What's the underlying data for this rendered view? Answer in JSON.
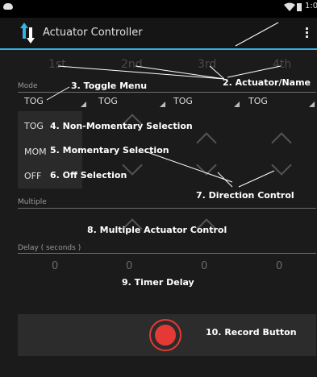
{
  "status_bar": {
    "time": "1:0",
    "wifi_icon": "wifi-icon",
    "battery_icon": "battery-icon",
    "cloud_icon": "cloud-upload-icon"
  },
  "action_bar": {
    "title": "Actuator Controller",
    "app_icon": "up-down-arrows-icon",
    "overflow_icon": "overflow-menu-icon"
  },
  "actuators": [
    "1st",
    "2nd",
    "3rd",
    "4th"
  ],
  "mode": {
    "label": "Mode",
    "values": [
      "TOG",
      "TOG",
      "TOG",
      "TOG"
    ]
  },
  "mode_menu": {
    "items": [
      "TOG",
      "MOM",
      "OFF"
    ]
  },
  "multiple": {
    "label": "Multiple"
  },
  "delay": {
    "label": "Delay ( seconds )",
    "values": [
      "0",
      "0",
      "0",
      "0"
    ]
  },
  "annotations": {
    "actuator_name": "2. Actuator/Name",
    "toggle_menu": "3. Toggle Menu",
    "non_momentary": "4. Non-Momentary Selection",
    "momentary": "5. Momentary Selection",
    "off_selection": "6. Off Selection",
    "direction": "7. Direction Control",
    "multiple": "8. Multiple Actuator Control",
    "timer": "9. Timer Delay",
    "record": "10. Record Button"
  },
  "colors": {
    "accent": "#33b5e5",
    "record": "#e53935",
    "background": "#1b1b1b"
  }
}
